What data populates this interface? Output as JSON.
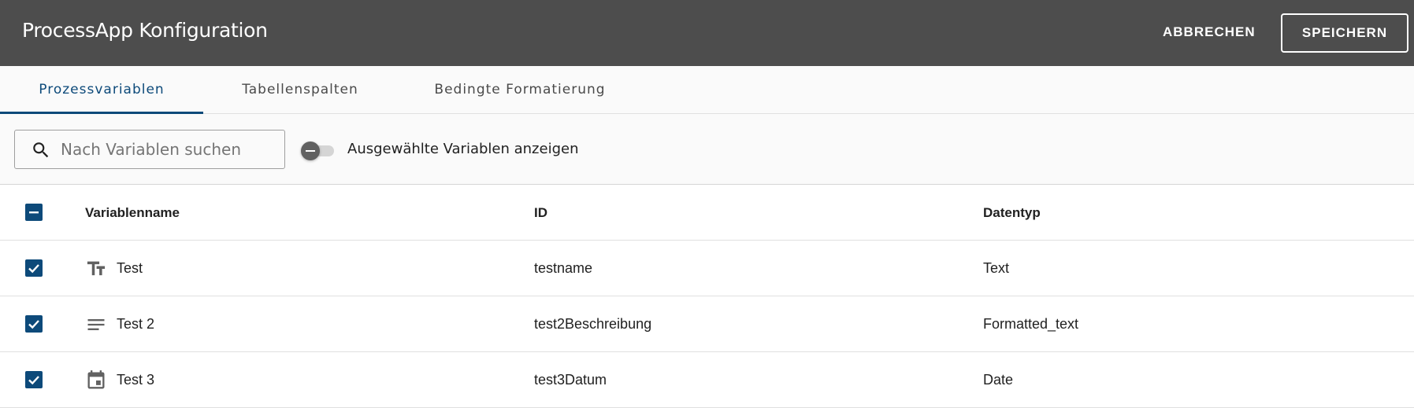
{
  "header": {
    "title": "ProcessApp Konfiguration",
    "cancel_label": "ABBRECHEN",
    "save_label": "SPEICHERN"
  },
  "tabs": [
    {
      "label": "Prozessvariablen",
      "active": true
    },
    {
      "label": "Tabellenspalten",
      "active": false
    },
    {
      "label": "Bedingte Formatierung",
      "active": false
    }
  ],
  "toolbar": {
    "search_placeholder": "Nach Variablen suchen",
    "search_value": "",
    "toggle_label": "Ausgewählte Variablen anzeigen",
    "toggle_on": false
  },
  "table": {
    "columns": [
      "Variablenname",
      "ID",
      "Datentyp"
    ],
    "header_checkbox": "indeterminate",
    "rows": [
      {
        "name": "Test",
        "id": "testname",
        "type": "Text",
        "icon": "text-fields-icon",
        "checked": true
      },
      {
        "name": "Test 2",
        "id": "test2Beschreibung",
        "type": "Formatted_text",
        "icon": "notes-icon",
        "checked": true
      },
      {
        "name": "Test 3",
        "id": "test3Datum",
        "type": "Date",
        "icon": "calendar-icon",
        "checked": true
      }
    ]
  },
  "colors": {
    "header_bg": "#4d4d4d",
    "accent": "#0d4a7a",
    "surface": "#fafafa"
  }
}
